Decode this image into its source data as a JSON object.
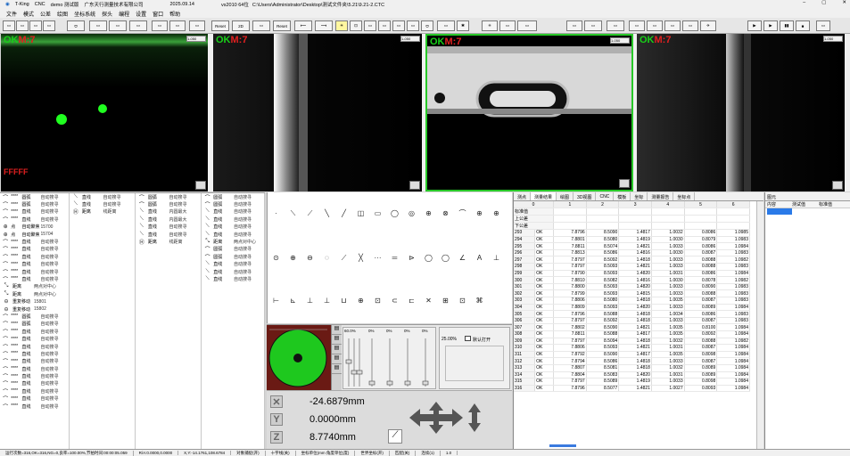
{
  "titlebar": {
    "app": "T-King",
    "mode": "CNC",
    "user": "demo 测试版",
    "company": "广东天行测量技术有限公司",
    "date": "2025.09.14",
    "version": "vs2010 64位",
    "path": "C:\\Users\\Administrator\\Desktop\\测试文件夹\\5.21\\9.21-2.CTC"
  },
  "menu": [
    "文件",
    "模式",
    "公差",
    "绘图",
    "坐标系统",
    "探头",
    "编程",
    "设置",
    "窗口",
    "帮助"
  ],
  "toolbar": {
    "reset1": "Reset",
    "twod": "2D",
    "reset2": "Reset"
  },
  "cameras": [
    {
      "ok": "OK",
      "m": "M:7",
      "sel": "1-050",
      "overlay": "FFFFF"
    },
    {
      "ok": "OK",
      "m": "M:7",
      "sel": "1-050"
    },
    {
      "ok": "OK",
      "m": "M:7",
      "sel": "1-050"
    },
    {
      "ok": "OK",
      "m": "M:7",
      "sel": "1-050"
    }
  ],
  "commands": {
    "col1": [
      [
        "⌒",
        "****",
        "圆弧",
        "自动搜寻"
      ],
      [
        "⌒",
        "****",
        "圆弧",
        "自动搜寻"
      ],
      [
        "⌒",
        "****",
        "直线",
        "自动搜寻"
      ],
      [
        "⌒",
        "****",
        "直线",
        "自动搜寻"
      ],
      [
        "⊕",
        "点",
        "自动聚焦",
        "15700"
      ],
      [
        "⊕",
        "点",
        "自动聚焦",
        "15704"
      ],
      [
        "⌒",
        "****",
        "直线",
        "自动搜寻"
      ],
      [
        "⌒",
        "****",
        "直线",
        "自动搜寻"
      ],
      [
        "⌒",
        "****",
        "直线",
        "自动搜寻"
      ],
      [
        "⌒",
        "****",
        "直线",
        "自动搜寻"
      ],
      [
        "⌒",
        "****",
        "直线",
        "自动搜寻"
      ],
      [
        "⌒",
        "****",
        "直线",
        "自动搜寻"
      ],
      [
        "⤡",
        "距离",
        "两点对中心"
      ],
      [
        "⤡",
        "距离",
        "两点对中心"
      ],
      [
        "⊖",
        "重复移动",
        "15801"
      ],
      [
        "⊖",
        "重复移动",
        "15802"
      ],
      [
        "⌒",
        "****",
        "圆弧",
        "自动搜寻"
      ],
      [
        "⌒",
        "****",
        "圆弧",
        "自动搜寻"
      ],
      [
        "⌒",
        "****",
        "直线",
        "自动搜寻"
      ],
      [
        "⌒",
        "****",
        "直线",
        "自动搜寻"
      ],
      [
        "⌒",
        "****",
        "直线",
        "自动搜寻"
      ],
      [
        "⌒",
        "****",
        "直线",
        "自动搜寻"
      ],
      [
        "⌒",
        "****",
        "直线",
        "自动搜寻"
      ],
      [
        "⌒",
        "****",
        "直线",
        "自动搜寻"
      ],
      [
        "⌒",
        "****",
        "直线",
        "自动搜寻"
      ],
      [
        "⌒",
        "****",
        "直线",
        "自动搜寻"
      ],
      [
        "⌒",
        "****",
        "直线",
        "自动搜寻"
      ],
      [
        "⌒",
        "****",
        "直线",
        "自动搜寻"
      ],
      [
        "⌒",
        "****",
        "直线",
        "自动搜寻"
      ]
    ],
    "col2": [
      [
        "⟍",
        "直线",
        "自动搜寻"
      ],
      [
        "⟍",
        "直线",
        "自动搜寻"
      ],
      [
        "Ⓗ",
        "距离",
        "线距离"
      ]
    ],
    "col3": [
      [
        "⌒",
        "圆弧",
        "自动搜寻"
      ],
      [
        "⌒",
        "圆弧",
        "自动搜寻"
      ],
      [
        "⟍",
        "直线",
        "内圆最大"
      ],
      [
        "⟍",
        "直线",
        "内圆最大"
      ],
      [
        "⟍",
        "直线",
        "自动搜寻"
      ],
      [
        "⟍",
        "直线",
        "自动搜寻"
      ],
      [
        "Ⓗ",
        "距离",
        "线距离"
      ]
    ],
    "col4": [
      [
        "⌒",
        "圆弧",
        "自动搜寻"
      ],
      [
        "⌒",
        "圆弧",
        "自动搜寻"
      ],
      [
        "⟍",
        "直线",
        "自动搜寻"
      ],
      [
        "⟍",
        "直线",
        "自动搜寻"
      ],
      [
        "⟍",
        "直线",
        "自动搜寻"
      ],
      [
        "⟍",
        "直线",
        "自动搜寻"
      ],
      [
        "⤡",
        "距离",
        "两点对中心"
      ],
      [
        "⌒",
        "圆弧",
        "自动搜寻"
      ],
      [
        "⌒",
        "圆弧",
        "自动搜寻"
      ],
      [
        "⟍",
        "直线",
        "自动搜寻"
      ],
      [
        "⟍",
        "直线",
        "自动搜寻"
      ],
      [
        "⟍",
        "直线",
        "自动搜寻"
      ]
    ]
  },
  "tools": {
    "row1": [
      "·",
      "⟍",
      "⟋",
      "╲",
      "╱",
      "◫",
      "▭",
      "◯",
      "◎",
      "⊕",
      "⊗",
      "⌒",
      "⊕",
      "⊕"
    ],
    "row2": [
      "⊙",
      "⊕",
      "⊖",
      "◌",
      "⟋",
      "╳",
      "···",
      "═",
      "⊳",
      "◯",
      "◯",
      "∠",
      "A",
      "⊥"
    ],
    "row3": [
      "⊢",
      "⊾",
      "⊥",
      "⊥",
      "⊔",
      "⊕",
      "⊡",
      "⊂",
      "⊏",
      "✕",
      "⊞",
      "⊡",
      "⌘"
    ]
  },
  "light": {
    "pct1": "60.0%",
    "pct2": "0%",
    "pct3": "0%",
    "pct4": "0%",
    "pct5": "0%",
    "zoom": "25.00%",
    "checkbox": "默认打开"
  },
  "coords": {
    "x": "-24.6879mm",
    "y": "0.0000mm",
    "z": "8.7740mm"
  },
  "table": {
    "tabs": [
      "测点",
      "测量结果",
      "绘图",
      "3D视图",
      "CNC",
      "模板",
      "坐标",
      "测量报告",
      "坐标点"
    ],
    "head": [
      "0",
      "1",
      "2",
      "3",
      "4",
      "5",
      "6"
    ],
    "labels": [
      "标准值",
      "上公差",
      "下公差"
    ],
    "rows": [
      [
        "293",
        "OK",
        "7.8796",
        "8.5090",
        "1.4817",
        "1.0032",
        "0.8086",
        "1.0985"
      ],
      [
        "294",
        "OK",
        "7.8801",
        "8.5080",
        "1.4819",
        "1.0030",
        "0.8079",
        "1.0983"
      ],
      [
        "295",
        "OK",
        "7.8811",
        "8.5074",
        "1.4821",
        "1.0033",
        "0.8086",
        "1.0984"
      ],
      [
        "296",
        "OK",
        "7.8813",
        "8.5086",
        "1.4816",
        "1.0030",
        "0.8087",
        "1.0983"
      ],
      [
        "297",
        "OK",
        "7.8797",
        "8.5092",
        "1.4818",
        "1.0033",
        "0.8088",
        "1.0982"
      ],
      [
        "298",
        "OK",
        "7.8797",
        "8.5093",
        "1.4821",
        "1.0033",
        "0.8088",
        "1.0983"
      ],
      [
        "299",
        "OK",
        "7.8790",
        "8.5093",
        "1.4820",
        "1.0031",
        "0.8086",
        "1.0984"
      ],
      [
        "300",
        "OK",
        "7.8810",
        "8.5082",
        "1.4816",
        "1.0030",
        "0.8078",
        "1.0982"
      ],
      [
        "301",
        "OK",
        "7.8800",
        "8.5093",
        "1.4820",
        "1.0033",
        "0.8090",
        "1.0983"
      ],
      [
        "302",
        "OK",
        "7.8799",
        "8.5093",
        "1.4815",
        "1.0033",
        "0.8088",
        "1.0983"
      ],
      [
        "303",
        "OK",
        "7.8806",
        "8.5080",
        "1.4818",
        "1.0035",
        "0.8087",
        "1.0983"
      ],
      [
        "304",
        "OK",
        "7.8809",
        "8.5093",
        "1.4820",
        "1.0033",
        "0.8089",
        "1.0984"
      ],
      [
        "305",
        "OK",
        "7.8796",
        "8.5088",
        "1.4818",
        "1.0034",
        "0.8086",
        "1.0983"
      ],
      [
        "306",
        "OK",
        "7.8797",
        "8.5092",
        "1.4818",
        "1.0033",
        "0.8087",
        "1.0983"
      ],
      [
        "307",
        "OK",
        "7.8802",
        "8.5090",
        "1.4821",
        "1.0035",
        "0.8100",
        "1.0984"
      ],
      [
        "308",
        "OK",
        "7.8811",
        "8.5088",
        "1.4817",
        "1.0035",
        "0.8092",
        "1.0984"
      ],
      [
        "309",
        "OK",
        "7.8797",
        "8.5094",
        "1.4818",
        "1.0032",
        "0.8088",
        "1.0982"
      ],
      [
        "310",
        "OK",
        "7.8806",
        "8.5093",
        "1.4821",
        "1.0031",
        "0.8087",
        "1.0984"
      ],
      [
        "311",
        "OK",
        "7.8792",
        "8.5090",
        "1.4817",
        "1.0035",
        "0.8098",
        "1.0984"
      ],
      [
        "312",
        "OK",
        "7.8794",
        "8.5086",
        "1.4818",
        "1.0033",
        "0.8087",
        "1.0984"
      ],
      [
        "313",
        "OK",
        "7.8807",
        "8.5081",
        "1.4818",
        "1.0032",
        "0.8089",
        "1.0984"
      ],
      [
        "314",
        "OK",
        "7.8804",
        "8.5083",
        "1.4820",
        "1.0031",
        "0.8089",
        "1.0984"
      ],
      [
        "315",
        "OK",
        "7.8797",
        "8.5089",
        "1.4819",
        "1.0033",
        "0.8098",
        "1.0984"
      ],
      [
        "316",
        "OK",
        "7.8796",
        "8.5077",
        "1.4821",
        "1.0027",
        "0.8093",
        "1.0984"
      ]
    ]
  },
  "right": {
    "tab": "图元",
    "cols": [
      "内容",
      "测试值",
      "标准值"
    ]
  },
  "status": [
    "运行次数=316,OK=316,NG=0,良率=100.00%,节拍时间:00:00:05.059",
    "R/A:0.0000,0.0000",
    "X,Y:-14.1761,108.6784",
    "对象捕捉(开)",
    "十字线(关)",
    "坐标单位(mm 角度单位(度)",
    "世界坐标(开)",
    "匹配(关)",
    "连续(1)",
    "1.0"
  ]
}
